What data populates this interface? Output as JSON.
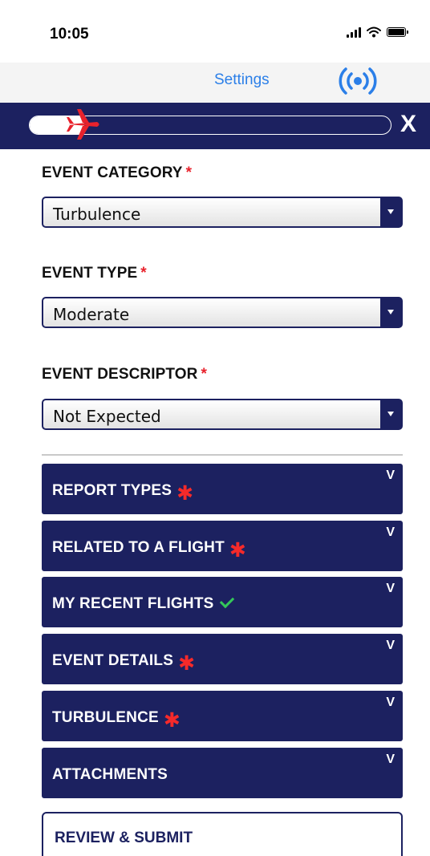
{
  "status_bar": {
    "time": "10:05",
    "icons": [
      "signal-icon",
      "wifi-icon",
      "battery-icon"
    ]
  },
  "top_nav": {
    "settings_label": "Settings",
    "broadcast_icon": "broadcast-icon",
    "accent_color": "#2b7fe8"
  },
  "progress": {
    "fraction": 0.15,
    "icon": "airplane-icon",
    "close_label": "X",
    "band_color": "#1c2160",
    "plane_color": "#e8222c"
  },
  "form": {
    "required_marker": "*",
    "event_category": {
      "label": "EVENT CATEGORY",
      "value": "Turbulence"
    },
    "event_type": {
      "label": "EVENT TYPE",
      "value": "Moderate"
    },
    "event_descriptor": {
      "label": "EVENT DESCRIPTOR",
      "value": "Not Expected"
    }
  },
  "sections": [
    {
      "title": "REPORT TYPES",
      "status": "required",
      "chevron": "V"
    },
    {
      "title": "RELATED TO A FLIGHT",
      "status": "required",
      "chevron": "V"
    },
    {
      "title": "MY RECENT FLIGHTS",
      "status": "complete",
      "chevron": "V"
    },
    {
      "title": "EVENT DETAILS",
      "status": "required",
      "chevron": "V"
    },
    {
      "title": "TURBULENCE",
      "status": "required",
      "chevron": "V"
    },
    {
      "title": "ATTACHMENTS",
      "status": "none",
      "chevron": "V"
    }
  ],
  "review_submit_label": "REVIEW & SUBMIT",
  "colors": {
    "navy": "#1c2160",
    "required_red": "#f52a2a",
    "complete_green": "#34c759"
  }
}
